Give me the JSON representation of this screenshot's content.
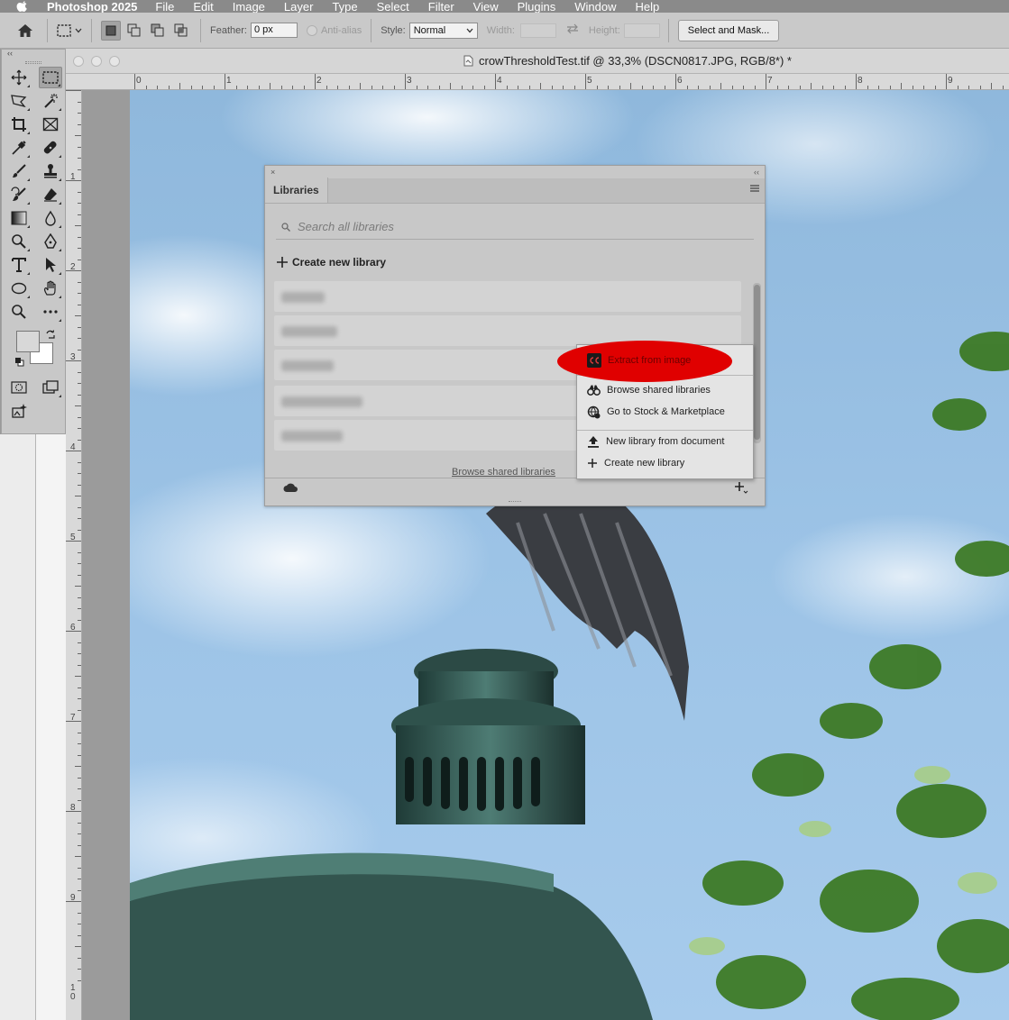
{
  "menubar": {
    "app_name": "Photoshop 2025",
    "items": [
      "File",
      "Edit",
      "Image",
      "Layer",
      "Type",
      "Select",
      "Filter",
      "View",
      "Plugins",
      "Window",
      "Help"
    ]
  },
  "options_bar": {
    "feather_label": "Feather:",
    "feather_value": "0 px",
    "antialias_label": "Anti-alias",
    "style_label": "Style:",
    "style_value": "Normal",
    "width_label": "Width:",
    "height_label": "Height:",
    "select_mask_label": "Select and Mask..."
  },
  "toolbar": {
    "collapse_glyph": "‹‹"
  },
  "document": {
    "title": "crowThresholdTest.tif @ 33,3% (DSCN0817.JPG, RGB/8*) *"
  },
  "rulers": {
    "top_numbers": [
      "0",
      "1",
      "2",
      "3",
      "4",
      "5",
      "6",
      "7",
      "8",
      "9"
    ],
    "left_numbers": [
      "1",
      "2",
      "3",
      "4",
      "5",
      "6",
      "7",
      "8",
      "9",
      "1\n0"
    ]
  },
  "libraries_panel": {
    "tab_label": "Libraries",
    "close_glyph": "×",
    "collapse_glyph": "‹‹",
    "search_placeholder": "Search all libraries",
    "create_new_label": "Create new library",
    "browse_shared_link": "Browse shared libraries"
  },
  "context_menu": {
    "items": [
      {
        "label": "Extract from image",
        "icon": "creative-cloud-icon",
        "highlighted": true
      },
      {
        "label": "Browse shared libraries",
        "icon": "binoculars-icon"
      },
      {
        "label": "Go to Stock & Marketplace",
        "icon": "stock-icon"
      },
      {
        "label": "New library from document",
        "icon": "upload-icon"
      },
      {
        "label": "Create new library",
        "icon": "plus-icon"
      }
    ],
    "highlight_color": "#e00000"
  },
  "colors": {
    "foreground": "#d8d8d8",
    "background": "#ffffff"
  }
}
